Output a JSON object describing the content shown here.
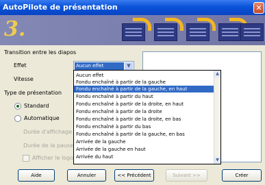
{
  "window": {
    "title": "AutoPilote de présentation",
    "close_glyph": "✕"
  },
  "banner": {
    "step_number": "3."
  },
  "transition": {
    "section_label": "Transition entre les diapos",
    "effect_label": "Effet",
    "speed_label": "Vitesse",
    "effect_value": "Aucun effet",
    "dropdown_glyph": "▼",
    "effect_options": [
      "Aucun effet",
      "Fondu enchaîné à partir de la gauche",
      "Fondu enchaîné à partir de la gauche, en haut",
      "Fondu enchaîné à partir du haut",
      "Fondu enchaîné à partir de la droite, en haut",
      "Fondu enchaîné à partir de la droite",
      "Fondu enchaîné à partir de la droite, en bas",
      "Fondu enchaîné à partir du bas",
      "Fondu enchaîné à partir de la gauche, en bas",
      "Arrivée de la gauche",
      "Arrivée de la gauche en haut",
      "Arrivée du haut"
    ],
    "highlighted_option": "Fondu enchaîné à partir de la gauche, en haut",
    "scroll_up_glyph": "▲",
    "scroll_down_glyph": "▼"
  },
  "presentation_type": {
    "section_label": "Type de présentation",
    "standard_label": "Standard",
    "automatic_label": "Automatique",
    "page_duration_label": "Durée d'affichage",
    "pause_duration_label": "Durée de la pause",
    "show_logo_label": "Afficher le logo",
    "selected": "Standard"
  },
  "buttons": {
    "help": "Aide",
    "cancel": "Annuler",
    "back": "<< Précédent",
    "next": "Suivant >>",
    "create": "Créer"
  },
  "colors": {
    "title_bar": "#0a53d8",
    "banner": "#7b7fae",
    "selection": "#316ac5",
    "step_number": "#f0cc4e"
  }
}
